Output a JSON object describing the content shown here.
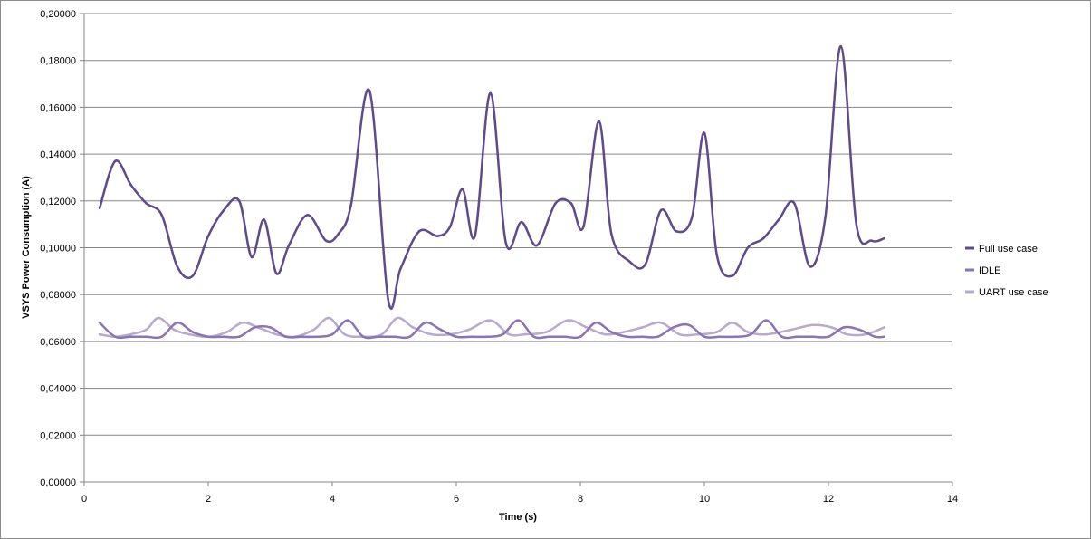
{
  "chart_data": {
    "type": "line",
    "title": "",
    "xlabel": "Time (s)",
    "ylabel": "VSYS Power Consumption (A)",
    "xlim": [
      0,
      14
    ],
    "ylim": [
      0,
      0.2
    ],
    "x_ticks": [
      "0",
      "2",
      "4",
      "6",
      "8",
      "10",
      "12",
      "14"
    ],
    "y_ticks": [
      "0,00000",
      "0,02000",
      "0,04000",
      "0,06000",
      "0,08000",
      "0,10000",
      "0,12000",
      "0,14000",
      "0,16000",
      "0,18000",
      "0,20000"
    ],
    "grid": "horizontal",
    "legend_position": "right",
    "series": [
      {
        "name": "Full use case",
        "color": "#5f4b8b",
        "x": [
          0.25,
          0.5,
          0.75,
          1.0,
          1.25,
          1.5,
          1.75,
          2.0,
          2.25,
          2.5,
          2.7,
          2.9,
          3.1,
          3.3,
          3.6,
          3.9,
          4.1,
          4.3,
          4.6,
          4.9,
          5.1,
          5.4,
          5.7,
          5.9,
          6.1,
          6.3,
          6.55,
          6.8,
          7.05,
          7.3,
          7.6,
          7.85,
          8.05,
          8.3,
          8.5,
          8.8,
          9.05,
          9.3,
          9.55,
          9.8,
          10.0,
          10.2,
          10.45,
          10.7,
          10.95,
          11.2,
          11.45,
          11.7,
          11.95,
          12.2,
          12.45,
          12.7,
          12.9
        ],
        "values": [
          0.117,
          0.137,
          0.127,
          0.119,
          0.114,
          0.092,
          0.088,
          0.105,
          0.116,
          0.12,
          0.096,
          0.112,
          0.089,
          0.101,
          0.114,
          0.103,
          0.106,
          0.118,
          0.167,
          0.078,
          0.091,
          0.107,
          0.105,
          0.109,
          0.125,
          0.105,
          0.166,
          0.102,
          0.111,
          0.101,
          0.119,
          0.119,
          0.109,
          0.154,
          0.106,
          0.094,
          0.093,
          0.116,
          0.107,
          0.113,
          0.149,
          0.097,
          0.088,
          0.1,
          0.104,
          0.112,
          0.119,
          0.092,
          0.113,
          0.186,
          0.11,
          0.103,
          0.104
        ]
      },
      {
        "name": "IDLE",
        "color": "#8a74b4",
        "x": [
          0.25,
          0.5,
          0.75,
          1.0,
          1.25,
          1.5,
          1.75,
          2.0,
          2.25,
          2.5,
          2.75,
          3.0,
          3.25,
          3.5,
          3.75,
          4.0,
          4.25,
          4.5,
          4.75,
          5.0,
          5.25,
          5.5,
          5.75,
          6.0,
          6.25,
          6.5,
          6.75,
          7.0,
          7.25,
          7.5,
          7.75,
          8.0,
          8.25,
          8.5,
          8.75,
          9.0,
          9.25,
          9.5,
          9.75,
          10.0,
          10.25,
          10.5,
          10.75,
          11.0,
          11.25,
          11.5,
          11.75,
          12.0,
          12.25,
          12.5,
          12.75,
          12.9
        ],
        "values": [
          0.068,
          0.062,
          0.062,
          0.062,
          0.062,
          0.068,
          0.064,
          0.062,
          0.062,
          0.062,
          0.066,
          0.066,
          0.062,
          0.062,
          0.062,
          0.063,
          0.069,
          0.062,
          0.062,
          0.062,
          0.062,
          0.068,
          0.065,
          0.062,
          0.062,
          0.062,
          0.063,
          0.069,
          0.062,
          0.062,
          0.062,
          0.062,
          0.068,
          0.064,
          0.062,
          0.062,
          0.062,
          0.066,
          0.067,
          0.062,
          0.062,
          0.062,
          0.063,
          0.069,
          0.062,
          0.062,
          0.062,
          0.062,
          0.066,
          0.065,
          0.062,
          0.062
        ]
      },
      {
        "name": "UART  use case",
        "color": "#b7aacb",
        "x": [
          0.25,
          0.5,
          0.75,
          1.0,
          1.2,
          1.45,
          1.7,
          2.0,
          2.3,
          2.55,
          2.8,
          3.1,
          3.4,
          3.7,
          3.95,
          4.2,
          4.5,
          4.8,
          5.05,
          5.3,
          5.6,
          5.9,
          6.2,
          6.55,
          6.85,
          7.1,
          7.45,
          7.8,
          8.1,
          8.4,
          8.7,
          9.0,
          9.3,
          9.6,
          9.9,
          10.2,
          10.45,
          10.7,
          11.0,
          11.4,
          11.75,
          12.05,
          12.3,
          12.6,
          12.9
        ],
        "values": [
          0.063,
          0.062,
          0.063,
          0.065,
          0.07,
          0.065,
          0.063,
          0.062,
          0.064,
          0.068,
          0.066,
          0.063,
          0.062,
          0.065,
          0.07,
          0.063,
          0.062,
          0.063,
          0.07,
          0.066,
          0.063,
          0.063,
          0.065,
          0.069,
          0.063,
          0.063,
          0.064,
          0.069,
          0.066,
          0.063,
          0.064,
          0.066,
          0.068,
          0.063,
          0.063,
          0.064,
          0.068,
          0.064,
          0.063,
          0.065,
          0.067,
          0.066,
          0.063,
          0.063,
          0.066
        ]
      }
    ]
  }
}
